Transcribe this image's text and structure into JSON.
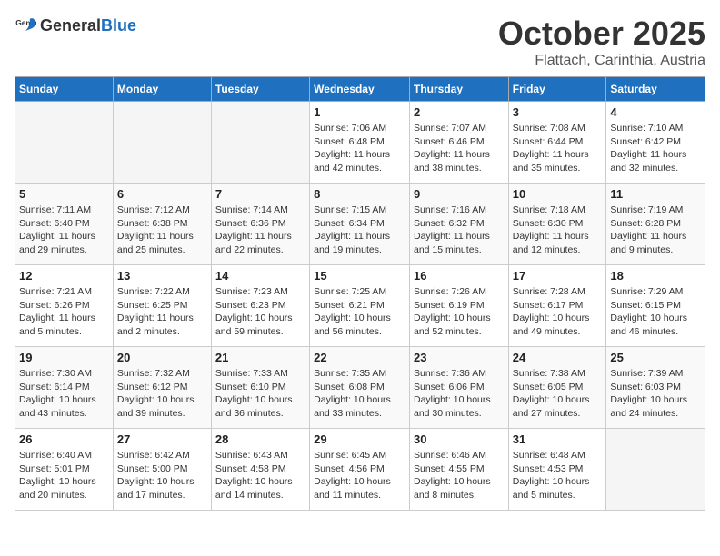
{
  "logo": {
    "general": "General",
    "blue": "Blue"
  },
  "title": "October 2025",
  "location": "Flattach, Carinthia, Austria",
  "days_of_week": [
    "Sunday",
    "Monday",
    "Tuesday",
    "Wednesday",
    "Thursday",
    "Friday",
    "Saturday"
  ],
  "weeks": [
    [
      {
        "day": "",
        "info": ""
      },
      {
        "day": "",
        "info": ""
      },
      {
        "day": "",
        "info": ""
      },
      {
        "day": "1",
        "info": "Sunrise: 7:06 AM\nSunset: 6:48 PM\nDaylight: 11 hours and 42 minutes."
      },
      {
        "day": "2",
        "info": "Sunrise: 7:07 AM\nSunset: 6:46 PM\nDaylight: 11 hours and 38 minutes."
      },
      {
        "day": "3",
        "info": "Sunrise: 7:08 AM\nSunset: 6:44 PM\nDaylight: 11 hours and 35 minutes."
      },
      {
        "day": "4",
        "info": "Sunrise: 7:10 AM\nSunset: 6:42 PM\nDaylight: 11 hours and 32 minutes."
      }
    ],
    [
      {
        "day": "5",
        "info": "Sunrise: 7:11 AM\nSunset: 6:40 PM\nDaylight: 11 hours and 29 minutes."
      },
      {
        "day": "6",
        "info": "Sunrise: 7:12 AM\nSunset: 6:38 PM\nDaylight: 11 hours and 25 minutes."
      },
      {
        "day": "7",
        "info": "Sunrise: 7:14 AM\nSunset: 6:36 PM\nDaylight: 11 hours and 22 minutes."
      },
      {
        "day": "8",
        "info": "Sunrise: 7:15 AM\nSunset: 6:34 PM\nDaylight: 11 hours and 19 minutes."
      },
      {
        "day": "9",
        "info": "Sunrise: 7:16 AM\nSunset: 6:32 PM\nDaylight: 11 hours and 15 minutes."
      },
      {
        "day": "10",
        "info": "Sunrise: 7:18 AM\nSunset: 6:30 PM\nDaylight: 11 hours and 12 minutes."
      },
      {
        "day": "11",
        "info": "Sunrise: 7:19 AM\nSunset: 6:28 PM\nDaylight: 11 hours and 9 minutes."
      }
    ],
    [
      {
        "day": "12",
        "info": "Sunrise: 7:21 AM\nSunset: 6:26 PM\nDaylight: 11 hours and 5 minutes."
      },
      {
        "day": "13",
        "info": "Sunrise: 7:22 AM\nSunset: 6:25 PM\nDaylight: 11 hours and 2 minutes."
      },
      {
        "day": "14",
        "info": "Sunrise: 7:23 AM\nSunset: 6:23 PM\nDaylight: 10 hours and 59 minutes."
      },
      {
        "day": "15",
        "info": "Sunrise: 7:25 AM\nSunset: 6:21 PM\nDaylight: 10 hours and 56 minutes."
      },
      {
        "day": "16",
        "info": "Sunrise: 7:26 AM\nSunset: 6:19 PM\nDaylight: 10 hours and 52 minutes."
      },
      {
        "day": "17",
        "info": "Sunrise: 7:28 AM\nSunset: 6:17 PM\nDaylight: 10 hours and 49 minutes."
      },
      {
        "day": "18",
        "info": "Sunrise: 7:29 AM\nSunset: 6:15 PM\nDaylight: 10 hours and 46 minutes."
      }
    ],
    [
      {
        "day": "19",
        "info": "Sunrise: 7:30 AM\nSunset: 6:14 PM\nDaylight: 10 hours and 43 minutes."
      },
      {
        "day": "20",
        "info": "Sunrise: 7:32 AM\nSunset: 6:12 PM\nDaylight: 10 hours and 39 minutes."
      },
      {
        "day": "21",
        "info": "Sunrise: 7:33 AM\nSunset: 6:10 PM\nDaylight: 10 hours and 36 minutes."
      },
      {
        "day": "22",
        "info": "Sunrise: 7:35 AM\nSunset: 6:08 PM\nDaylight: 10 hours and 33 minutes."
      },
      {
        "day": "23",
        "info": "Sunrise: 7:36 AM\nSunset: 6:06 PM\nDaylight: 10 hours and 30 minutes."
      },
      {
        "day": "24",
        "info": "Sunrise: 7:38 AM\nSunset: 6:05 PM\nDaylight: 10 hours and 27 minutes."
      },
      {
        "day": "25",
        "info": "Sunrise: 7:39 AM\nSunset: 6:03 PM\nDaylight: 10 hours and 24 minutes."
      }
    ],
    [
      {
        "day": "26",
        "info": "Sunrise: 6:40 AM\nSunset: 5:01 PM\nDaylight: 10 hours and 20 minutes."
      },
      {
        "day": "27",
        "info": "Sunrise: 6:42 AM\nSunset: 5:00 PM\nDaylight: 10 hours and 17 minutes."
      },
      {
        "day": "28",
        "info": "Sunrise: 6:43 AM\nSunset: 4:58 PM\nDaylight: 10 hours and 14 minutes."
      },
      {
        "day": "29",
        "info": "Sunrise: 6:45 AM\nSunset: 4:56 PM\nDaylight: 10 hours and 11 minutes."
      },
      {
        "day": "30",
        "info": "Sunrise: 6:46 AM\nSunset: 4:55 PM\nDaylight: 10 hours and 8 minutes."
      },
      {
        "day": "31",
        "info": "Sunrise: 6:48 AM\nSunset: 4:53 PM\nDaylight: 10 hours and 5 minutes."
      },
      {
        "day": "",
        "info": ""
      }
    ]
  ]
}
